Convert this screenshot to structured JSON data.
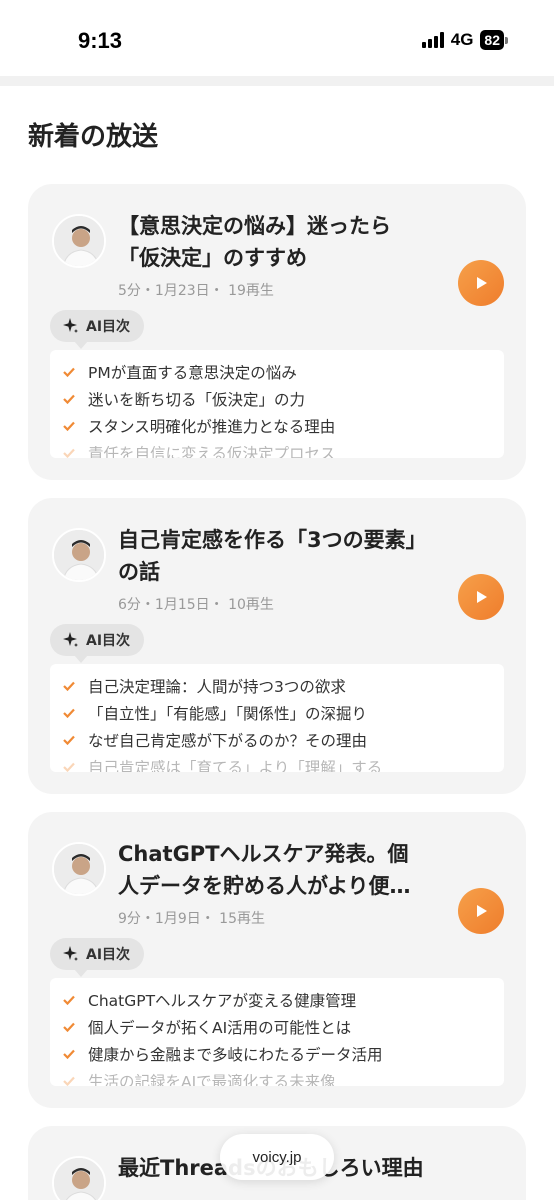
{
  "status_bar": {
    "time": "9:13",
    "network": "4G",
    "battery": "82"
  },
  "section_title": "新着の放送",
  "ai_toc_label": "AI目次",
  "episodes": [
    {
      "title": "【意思決定の悩み】迷ったら「仮決定」のすすめ",
      "meta": "5分・1月23日・ 19再生",
      "toc": [
        "PMが直面する意思決定の悩み",
        "迷いを断ち切る「仮決定」の力",
        "スタンス明確化が推進力となる理由",
        "責任を自信に変える仮決定プロセス"
      ]
    },
    {
      "title": "自己肯定感を作る「3つの要素」の話",
      "meta": "6分・1月15日・ 10再生",
      "toc": [
        "自己決定理論：人間が持つ3つの欲求",
        "「自立性」「有能感」「関係性」の深掘り",
        "なぜ自己肯定感が下がるのか？その理由",
        "自己肯定感は「育てる」より「理解」する"
      ]
    },
    {
      "title": "ChatGPTヘルスケア発表。個人データを貯める人がより便…",
      "meta": "9分・1月9日・ 15再生",
      "toc": [
        "ChatGPTヘルスケアが変える健康管理",
        "個人データが拓くAI活用の可能性とは",
        "健康から金融まで多岐にわたるデータ活用",
        "生活の記録をAIで最適化する未来像"
      ]
    },
    {
      "title": "最近Threadsのおもしろい理由"
    }
  ],
  "browser": {
    "url": "voicy.jp"
  },
  "colors": {
    "accent": "#f08a35",
    "card": "#f4f4f4"
  },
  "icons": {
    "play": "play-icon",
    "ai": "sparkle-icon",
    "check": "check-icon"
  }
}
